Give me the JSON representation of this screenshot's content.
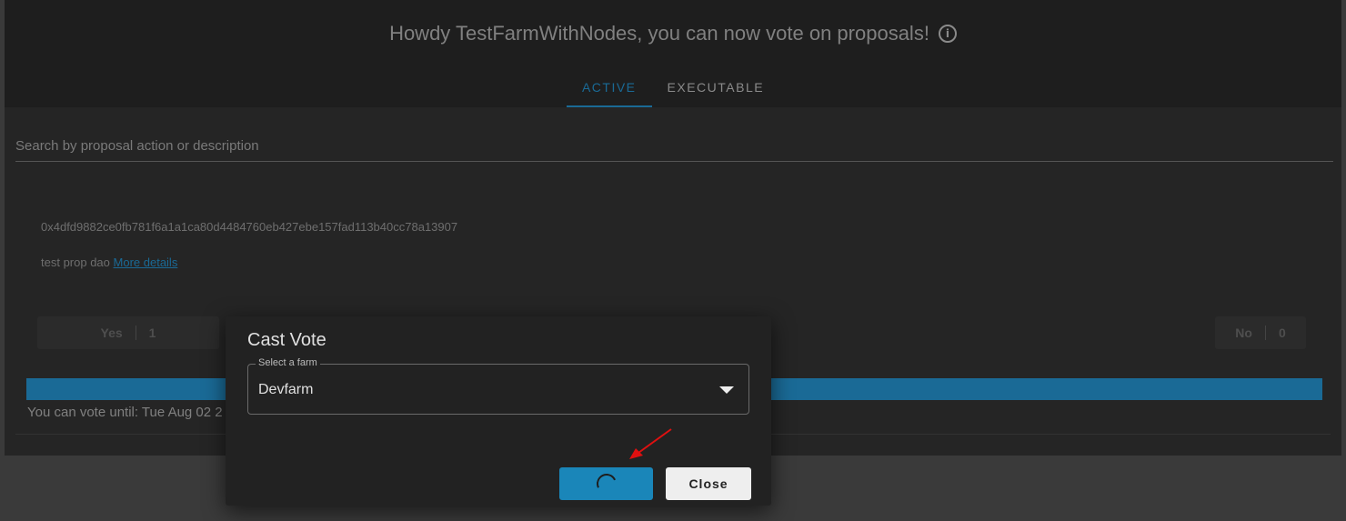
{
  "header": {
    "greeting": "Howdy TestFarmWithNodes, you can now vote on proposals!",
    "info_icon": "info-circle-icon",
    "tabs": [
      {
        "label": "ACTIVE",
        "active": true
      },
      {
        "label": "EXECUTABLE",
        "active": false
      }
    ]
  },
  "search": {
    "placeholder": "Search by proposal action or description"
  },
  "proposal": {
    "hash": "0x4dfd9882ce0fb781f6a1a1ca80d4484760eb427ebe157fad113b40cc78a13907",
    "description": "test prop dao",
    "details_link": "More details",
    "yes_label": "Yes",
    "yes_count": "1",
    "no_label": "No",
    "no_count": "0",
    "vote_until": "You can vote until: Tue Aug 02 2"
  },
  "modal": {
    "title": "Cast Vote",
    "select_label": "Select a farm",
    "selected_farm": "Devfarm",
    "close_label": "Close",
    "submit_state": "loading"
  },
  "colors": {
    "accent": "#1a6a96",
    "button_blue": "#1a86b9",
    "annotation_arrow": "#e01010"
  }
}
